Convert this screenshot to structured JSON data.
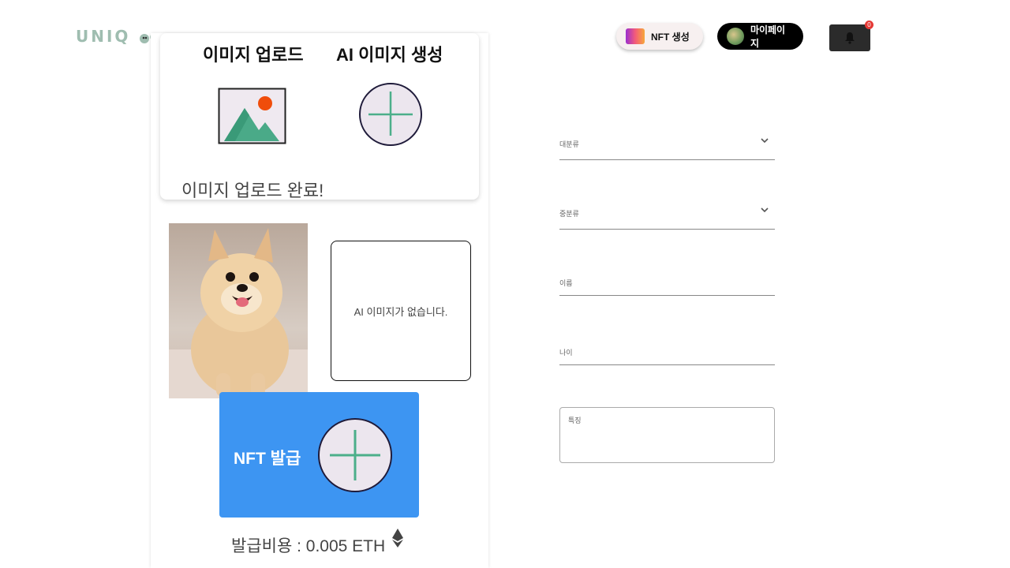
{
  "header": {
    "logo_text": "UNIQ",
    "nft_create_label": "NFT 생성",
    "mypage_label": "마이페이지",
    "notification_count": "0"
  },
  "upload": {
    "tab_upload": "이미지 업로드",
    "tab_ai": "AI 이미지 생성",
    "status": "이미지 업로드 완료!"
  },
  "preview": {
    "ai_empty_text": "AI 이미지가 없습니다."
  },
  "mint": {
    "label": "NFT 발급",
    "fee_text": "발급비용 : 0.005 ETH"
  },
  "form": {
    "category_major_label": "대분류",
    "category_minor_label": "중분류",
    "name_label": "이름",
    "age_label": "나이",
    "traits_label": "특징"
  },
  "colors": {
    "accent_blue": "#3d95f2",
    "plus_green": "#4caf8a",
    "badge_red": "#e53935"
  }
}
